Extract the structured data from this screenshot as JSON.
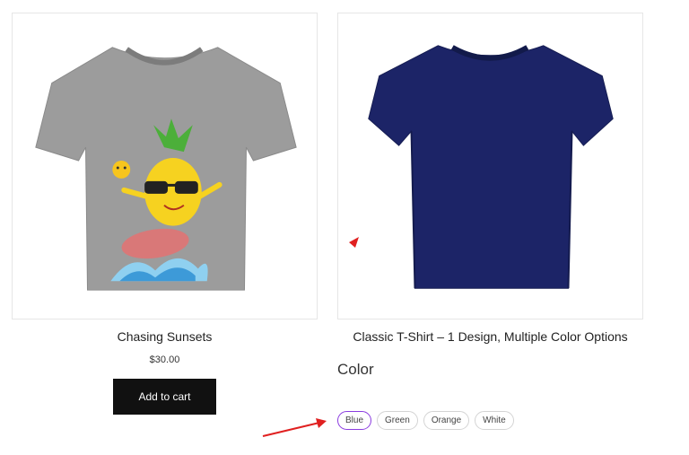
{
  "products": [
    {
      "title": "Chasing Sunsets",
      "price": "$30.00",
      "button_label": "Add to cart",
      "image": "gray-tshirt-pineapple-surfer"
    },
    {
      "title": "Classic T-Shirt – 1 Design, Multiple Color Options",
      "image": "navy-tshirt"
    }
  ],
  "color_option": {
    "label": "Color",
    "options": [
      "Blue",
      "Green",
      "Orange",
      "White"
    ],
    "selected": "Blue"
  },
  "colors": {
    "selected_border": "#8b3ce0",
    "button_bg": "#111111",
    "arrow": "#e02020",
    "navy_shirt": "#1c2467",
    "gray_shirt": "#9a9a9a"
  }
}
